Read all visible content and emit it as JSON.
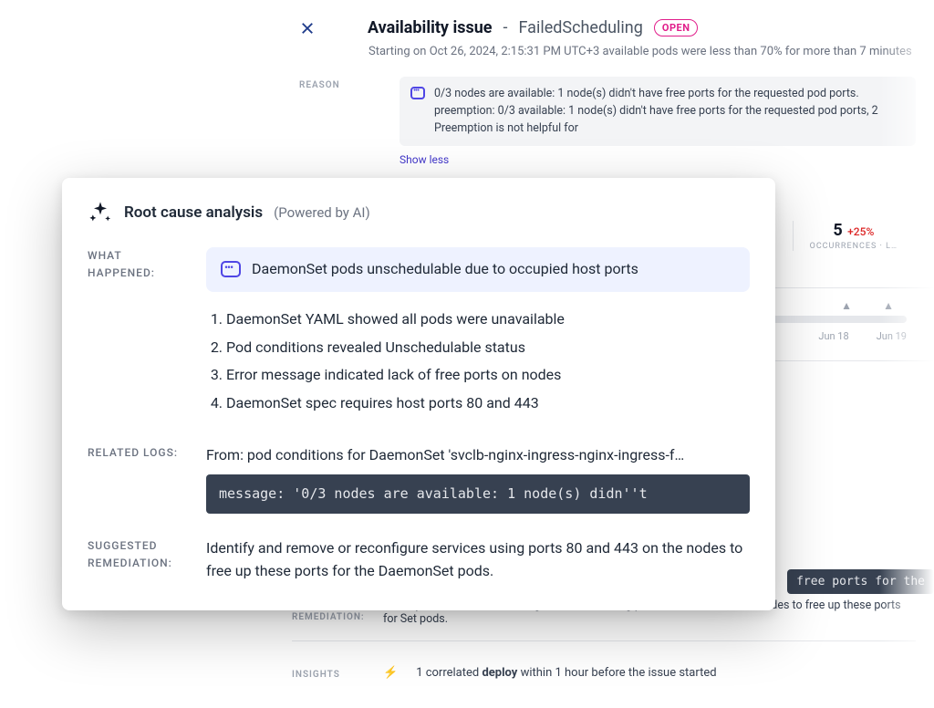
{
  "drawer": {
    "title": "Availability issue",
    "subtitle_sep": "-",
    "subtitle": "FailedScheduling",
    "status": "OPEN",
    "meta": "Starting on Oct 26, 2024, 2:15:31 PM UTC+3 available pods were less than 70% for more than 7 minutes",
    "reason_label": "REASON",
    "reason_text": "0/3 nodes are available: 1 node(s) didn't have free ports for the requested pod ports. preemption: 0/3 available: 1 node(s) didn't have free ports for the requested pod ports, 2 Preemption is not helpful for",
    "show_less": "Show less",
    "stat_n": "5",
    "stat_delta": "+25%",
    "stat_label": "OCCURRENCES · L…",
    "tl_date1": "Jun 18",
    "tl_date2": "Jun 19",
    "code_bg": "free ports for the",
    "suggested_label": "SUGGESTED REMEDIATION:",
    "suggested_text": "Identify and remove or reconfigure services using ports 80 and 443 on the nodes to free up these ports for Set pods.",
    "insights_label": "INSIGHTS",
    "insights_text_pre": "1 correlated ",
    "insights_text_bold": "deploy",
    "insights_text_post": " within 1 hour before the issue started"
  },
  "rca": {
    "title": "Root cause analysis",
    "sub": "(Powered by AI)",
    "what_label": "WHAT HAPPENED:",
    "summary": "DaemonSet pods unschedulable due to occupied host ports",
    "steps": [
      "DaemonSet YAML showed all pods were unavailable",
      "Pod conditions revealed Unschedulable status",
      "Error message indicated lack of free ports on nodes",
      "DaemonSet spec requires host ports 80 and 443"
    ],
    "logs_label": "RELATED LOGS:",
    "logs_from": "From: pod conditions for DaemonSet 'svclb-nginx-ingress-nginx-ingress-f…",
    "logs_code": "message: '0/3 nodes are available: 1 node(s) didn''t",
    "rem_label": "SUGGESTED REMEDIATION:",
    "rem_text": "Identify and remove or reconfigure services using ports 80 and 443 on the nodes to free up these ports for the DaemonSet pods."
  }
}
